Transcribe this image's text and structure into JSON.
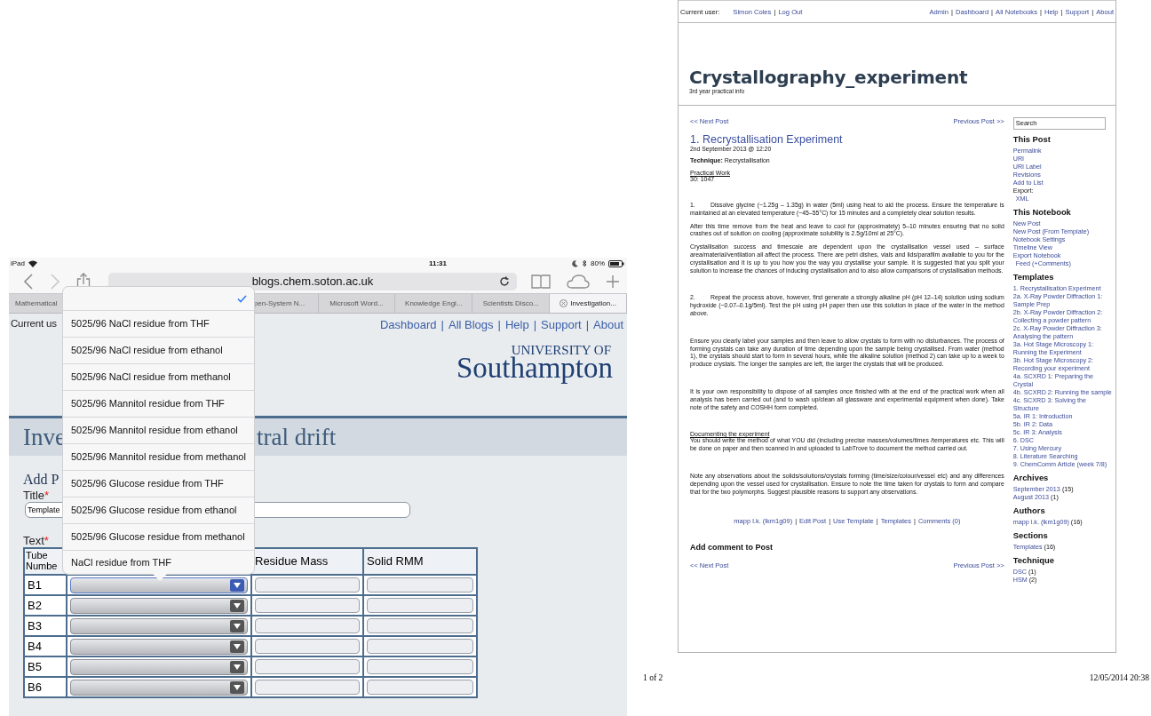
{
  "ipad": {
    "status_bar": {
      "device": "iPad",
      "time": "11:31",
      "battery": "80%"
    },
    "url": "blogs.chem.soton.ac.uk",
    "tabs": [
      {
        "label": "Mathematical",
        "selected": false
      },
      {
        "label": "pen-System N...",
        "selected": false
      },
      {
        "label": "Microsoft Word...",
        "selected": false
      },
      {
        "label": "Knowledge Engi...",
        "selected": false
      },
      {
        "label": "Scientists Disco...",
        "selected": false
      },
      {
        "label": "Investigation...",
        "selected": true
      }
    ],
    "current_user": "Current us",
    "nav": [
      "Dashboard",
      "All Blogs",
      "Help",
      "Support",
      "About"
    ],
    "separator": "|",
    "logo_small": "UNIVERSITY OF",
    "logo": "Southampton",
    "title_start": "Inve",
    "title_end": "tral drift",
    "heading": "Add P",
    "title_label": "Title",
    "required_mark": "*",
    "title_value": "Template",
    "text_label": "Text",
    "columns": [
      "Tube Numbe",
      "Residue Mass",
      "Solid RMM"
    ],
    "rows": [
      {
        "label": "B1",
        "focused": true
      },
      {
        "label": "B2",
        "focused": false
      },
      {
        "label": "B3",
        "focused": false
      },
      {
        "label": "B4",
        "focused": false
      },
      {
        "label": "B5",
        "focused": false
      },
      {
        "label": "B6",
        "focused": false
      }
    ],
    "picker": {
      "blank_selected": true,
      "options": [
        "5025/96 NaCl residue from THF",
        "5025/96 NaCl residue from ethanol",
        "5025/96 NaCl residue from methanol",
        "5025/96 Mannitol residue from THF",
        "5025/96 Mannitol residue from ethanol",
        "5025/96 Mannitol residue from methanol",
        "5025/96 Glucose residue from THF",
        "5025/96 Glucose residue from ethanol",
        "5025/96 Glucose residue from methanol",
        "NaCl residue from THF"
      ]
    }
  },
  "print_page": {
    "top_bar": {
      "label": "Current user:",
      "user_links": [
        "Simon Coles",
        "Log Out"
      ],
      "links": [
        "Admin",
        "Dashboard",
        "All Notebooks",
        "Help",
        "Support",
        "About"
      ],
      "separator": "|"
    },
    "blog_title": "Crystallography_experiment",
    "blog_subtitle": "3rd year practical info",
    "nav_top": {
      "next": "<< Next Post",
      "previous": "Previous Post >>"
    },
    "post": {
      "title": "1. Recrystallisation Experiment",
      "date": "2nd September 2013 @ 12:20",
      "technique": "**Technique:** Recrystallisation",
      "section_heading": "Practical Work",
      "section_value": "30: 1047",
      "blocks": [
        {
          "kind": "section",
          "number": "1.",
          "text": "Dissolve glycine (~1.25g – 1.35g) in water (5ml) using heat to aid the process. Ensure the temperature is maintained at an elevated temperature (~45–55°C) for 15 minutes and a completely clear solution results."
        },
        {
          "kind": "para",
          "text": "After this time remove from the heat and leave to cool for (approximately) 5–10 minutes ensuring that no solid crashes out of solution on cooling (approximate solubility is 2.5g/10ml at 25°C)."
        },
        {
          "kind": "para",
          "text": "Crystallisation success and timescale are dependent upon the crystallisation vessel used – surface area/material/ventilation all affect the process.  There are petri dishes, vials and lids/parafilm available to you for the crystallisation and it is up to you how you the way you crystallise your sample.  It is suggested that you split your solution to increase the chances of inducing crystallisation and to also allow comparisons of crystallisation methods."
        },
        {
          "kind": "section",
          "number": "2.",
          "text": "Repeat the process above, however, first generate a strongly alkaline pH (pH 12–14) solution using sodium hydroxide (~0.07–0.1g/5ml).  Test the pH using pH paper then use this solution in place of the water in the method above."
        },
        {
          "kind": "section",
          "text": "Ensure you clearly label your samples and then leave to allow crystals to form with no disturbances.  The process of forming crystals can take any duration of time depending upon the sample being crystallised.  From water (method 1), the crystals should start to form in several hours, while the alkaline solution (method 2) can take up to a week to produce crystals.  The longer the samples are left, the larger the crystals that will be produced."
        },
        {
          "kind": "section",
          "text": "It is your own responsibility to dispose of all samples once finished with at the end of the practical work when all analysis has been carried out (and to wash up/clean all glassware and experimental equipment when done). Take note of the safety and COSHH form completed."
        },
        {
          "kind": "section",
          "heading": "Documenting the experiment",
          "text": "You should write the method of what YOU did (including precise masses/volumes/times /temperatures etc.  This will be done on paper and then scanned in and uploaded to LabTrove to document the method carried out."
        },
        {
          "kind": "section",
          "text": "Note any observations about the solids/solutions/crystals forming (time/size/colour/vessel etc) and any differences depending upon the vessel used for crystallisation.  Ensure to note the time taken for crystals to form and compare that for the two polymorphs.  Suggest plausible reasons to support any observations."
        }
      ]
    },
    "post_links": [
      "mapp l.k. (lkm1g09)",
      "Edit Post",
      "Use Template",
      "Templates",
      "Comments (0)"
    ],
    "comment_heading": "Add comment to Post",
    "nav_bottom": {
      "next": "<< Next Post",
      "previous": "Previous Post >>"
    },
    "search": "Search",
    "sidebar": [
      {
        "heading": "This Post",
        "items": [
          {
            "kind": "link",
            "text": "Permalink"
          },
          {
            "kind": "link",
            "text": "URI"
          },
          {
            "kind": "link",
            "text": "URI Label"
          },
          {
            "kind": "link",
            "text": "Revisions"
          },
          {
            "kind": "link",
            "text": "Add to List"
          },
          {
            "kind": "label",
            "text": "Export:"
          },
          {
            "kind": "indent",
            "text": "XML"
          }
        ]
      },
      {
        "heading": "This Notebook",
        "items": [
          {
            "kind": "link",
            "text": "New Post"
          },
          {
            "kind": "link",
            "text": "New Post (From Template)"
          },
          {
            "kind": "link",
            "text": "Notebook Settings"
          },
          {
            "kind": "link",
            "text": "Timeline View"
          },
          {
            "kind": "link",
            "text": "Export Notebook"
          },
          {
            "kind": "indent",
            "text": "Feed (+Comments)"
          }
        ]
      },
      {
        "heading": "Templates",
        "items": [
          {
            "kind": "link",
            "text": "1. Recrystallisation Experiment"
          },
          {
            "kind": "link",
            "text": "2a. X-Ray Powder Diffraction 1: Sample Prep"
          },
          {
            "kind": "link",
            "text": "2b. X-Ray Powder Diffraction 2: Collecting a powder pattern"
          },
          {
            "kind": "link",
            "text": "2c. X-Ray Powder Diffraction 3: Analysing the pattern"
          },
          {
            "kind": "link",
            "text": "3a. Hot Stage Microscopy 1: Running the Experiment"
          },
          {
            "kind": "link",
            "text": "3b. Hot Stage Microscopy 2: Recording your experiment"
          },
          {
            "kind": "link",
            "text": "4a. SCXRD 1: Preparing the Crystal"
          },
          {
            "kind": "link",
            "text": "4b. SCXRD 2: Running the sample"
          },
          {
            "kind": "link",
            "text": "4c. SCXRD 3: Solving the Structure"
          },
          {
            "kind": "link",
            "text": "5a. IR 1: Introduction"
          },
          {
            "kind": "link",
            "text": "5b. IR 2: Data"
          },
          {
            "kind": "link",
            "text": "5c. IR 3: Analysis"
          },
          {
            "kind": "link",
            "text": "6. DSC"
          },
          {
            "kind": "link",
            "text": "7. Using Mercury"
          },
          {
            "kind": "link",
            "text": "8. Literature Searching"
          },
          {
            "kind": "link",
            "text": "9. ChemComm Article (week 7/8)"
          }
        ]
      },
      {
        "heading": "Archives",
        "items": [
          {
            "kind": "link",
            "text": "September 2013",
            "count": "(15)"
          },
          {
            "kind": "link",
            "text": "August 2013",
            "count": "(1)"
          }
        ]
      },
      {
        "heading": "Authors",
        "items": [
          {
            "kind": "link",
            "text": "mapp l.k. (lkm1g09)",
            "count": "(16)"
          }
        ]
      },
      {
        "heading": "Sections",
        "items": [
          {
            "kind": "link",
            "text": "Templates",
            "count": "(16)"
          }
        ]
      },
      {
        "heading": "Technique",
        "items": [
          {
            "kind": "link",
            "text": "DSC",
            "count": "(1)"
          },
          {
            "kind": "link",
            "text": "HSM",
            "count": "(2)"
          }
        ]
      }
    ],
    "footer": {
      "page": "1 of 2",
      "printed": "12/05/2014 20:38"
    }
  }
}
